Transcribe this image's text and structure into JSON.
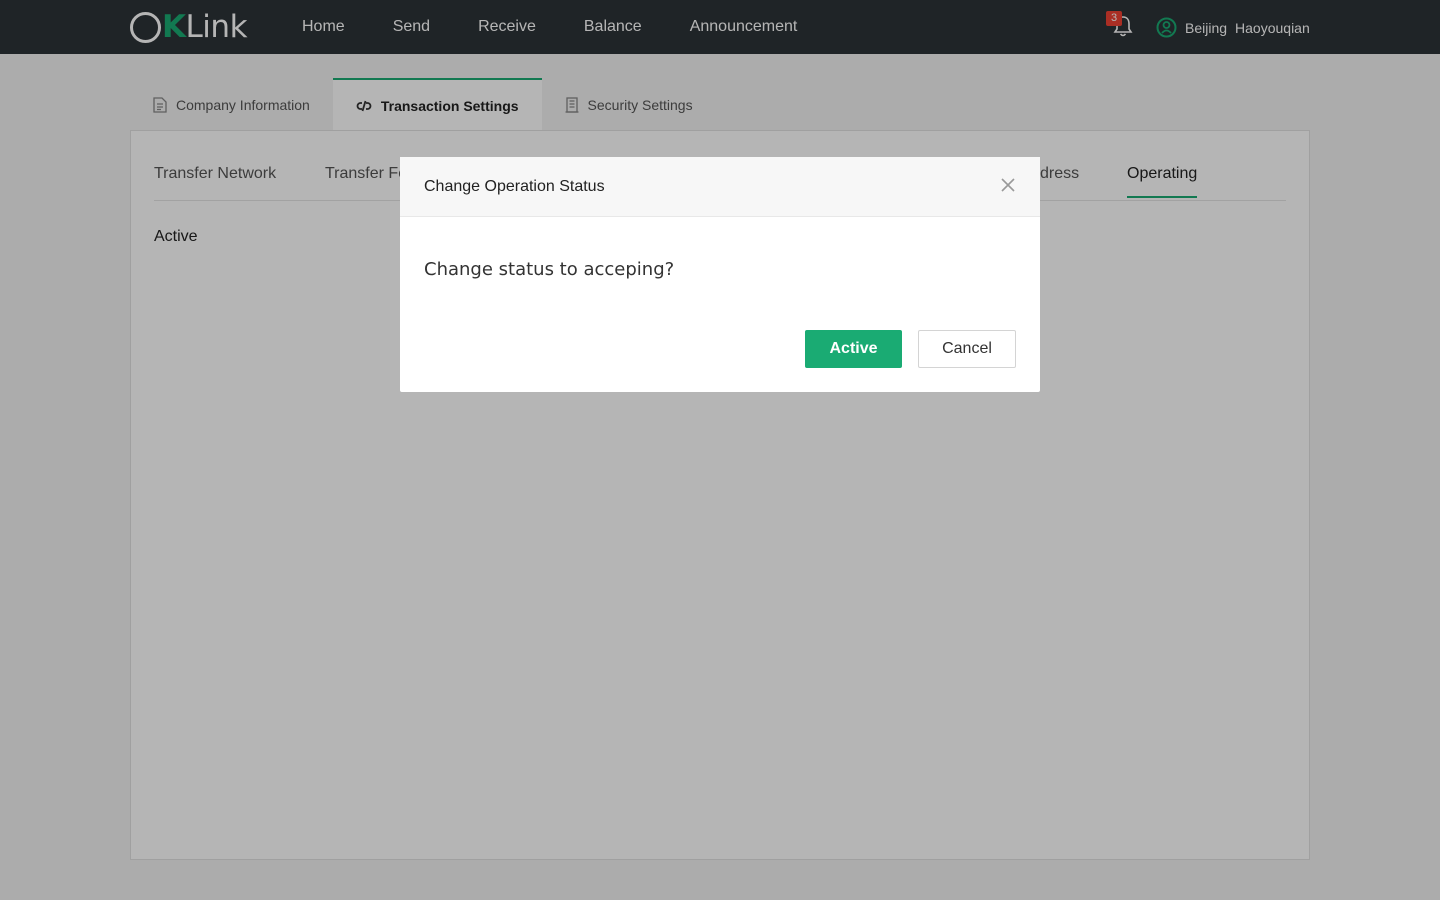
{
  "brand": {
    "logo_k": "K",
    "logo_rest": "Link"
  },
  "nav": {
    "items": [
      {
        "label": "Home"
      },
      {
        "label": "Send"
      },
      {
        "label": "Receive"
      },
      {
        "label": "Balance"
      },
      {
        "label": "Announcement"
      }
    ]
  },
  "notifications": {
    "count": "3",
    "icon": "bell-icon"
  },
  "user": {
    "city": "Beijing",
    "name": "Haoyouqian",
    "icon": "user-avatar-icon"
  },
  "page_tabs": [
    {
      "label": "Company Information",
      "icon": "document-icon",
      "active": false
    },
    {
      "label": "Transaction Settings",
      "icon": "link-icon",
      "active": true
    },
    {
      "label": "Security Settings",
      "icon": "building-icon",
      "active": false
    }
  ],
  "sub_tabs": [
    {
      "label": "Transfer Network"
    },
    {
      "label": "Transfer Fe"
    },
    {
      "label": "dress"
    },
    {
      "label": "Operating",
      "active": true
    }
  ],
  "content": {
    "status": "Active"
  },
  "modal": {
    "title": "Change Operation Status",
    "message": "Change status to acceping?",
    "confirm_label": "Active",
    "cancel_label": "Cancel"
  },
  "colors": {
    "accent": "#1aab73",
    "topbar": "#2d3337",
    "badge": "#f04134"
  }
}
